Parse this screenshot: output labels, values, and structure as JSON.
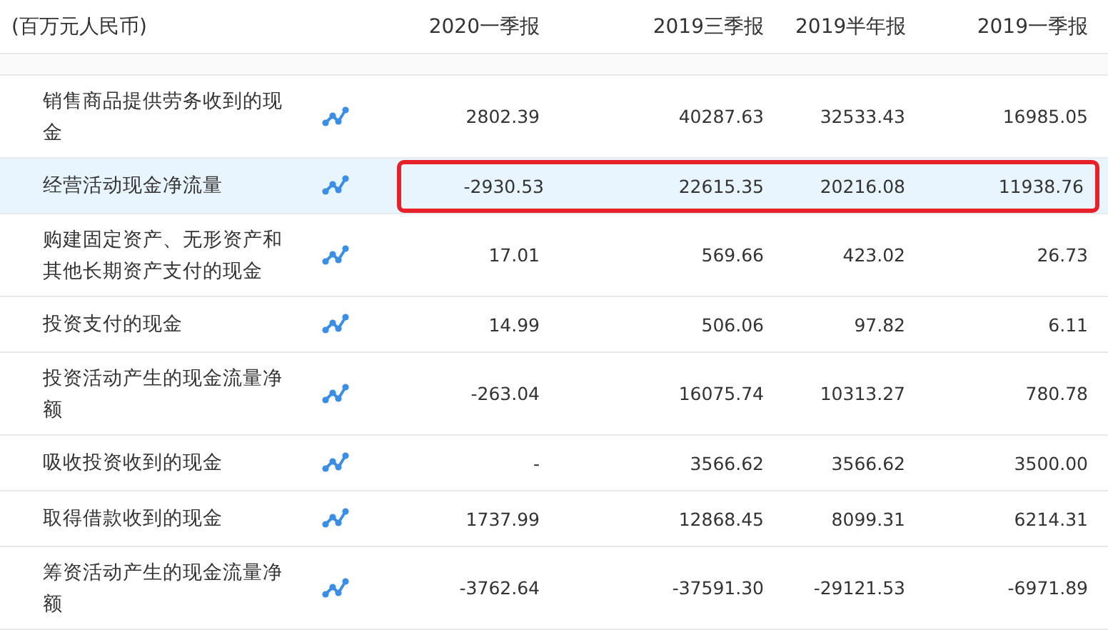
{
  "table": {
    "columns": [
      "(百万元人民币)",
      "2020一季报",
      "2019三季报",
      "2019半年报",
      "2019一季报"
    ],
    "rows": [
      {
        "label": "销售商品提供劳务收到的现金",
        "selected": false,
        "outlined": false,
        "values": [
          "2802.39",
          "40287.63",
          "32533.43",
          "16985.05"
        ]
      },
      {
        "label": "经营活动现金净流量",
        "selected": true,
        "outlined": true,
        "values": [
          "-2930.53",
          "22615.35",
          "20216.08",
          "11938.76"
        ]
      },
      {
        "label": "购建固定资产、无形资产和其他长期资产支付的现金",
        "selected": false,
        "outlined": false,
        "values": [
          "17.01",
          "569.66",
          "423.02",
          "26.73"
        ]
      },
      {
        "label": "投资支付的现金",
        "selected": false,
        "outlined": false,
        "values": [
          "14.99",
          "506.06",
          "97.82",
          "6.11"
        ]
      },
      {
        "label": "投资活动产生的现金流量净额",
        "selected": false,
        "outlined": false,
        "values": [
          "-263.04",
          "16075.74",
          "10313.27",
          "780.78"
        ]
      },
      {
        "label": "吸收投资收到的现金",
        "selected": false,
        "outlined": false,
        "values": [
          "-",
          "3566.62",
          "3566.62",
          "3500.00"
        ]
      },
      {
        "label": "取得借款收到的现金",
        "selected": false,
        "outlined": false,
        "values": [
          "1737.99",
          "12868.45",
          "8099.31",
          "6214.31"
        ]
      },
      {
        "label": "筹资活动产生的现金流量净额",
        "selected": false,
        "outlined": false,
        "values": [
          "-3762.64",
          "-37591.30",
          "-29121.53",
          "-6971.89"
        ]
      }
    ]
  }
}
